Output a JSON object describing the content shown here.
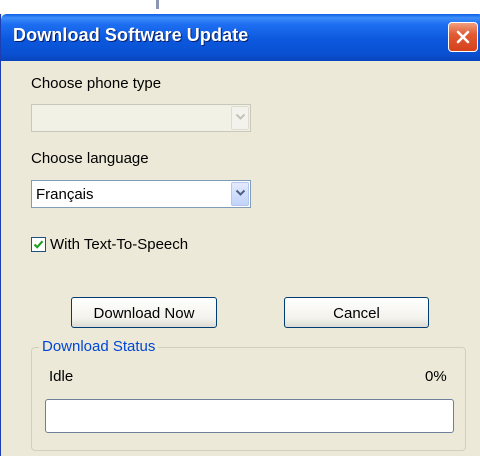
{
  "window": {
    "title": "Download Software Update"
  },
  "phone": {
    "label": "Choose phone type",
    "value": ""
  },
  "language": {
    "label": "Choose language",
    "value": "Français"
  },
  "tts": {
    "label": "With Text-To-Speech",
    "checked": true
  },
  "buttons": {
    "download": "Download Now",
    "cancel": "Cancel"
  },
  "status": {
    "group_title": "Download Status",
    "text": "Idle",
    "percent_text": "0%",
    "progress": 0
  },
  "colors": {
    "title_bar": "#0a50d2",
    "close_button": "#d4411b",
    "group_title": "#0046d5",
    "dialog_bg": "#ece9d8"
  },
  "icons": {
    "close": "close-x-icon",
    "dropdown": "chevron-down-icon",
    "check": "checkmark-icon"
  }
}
